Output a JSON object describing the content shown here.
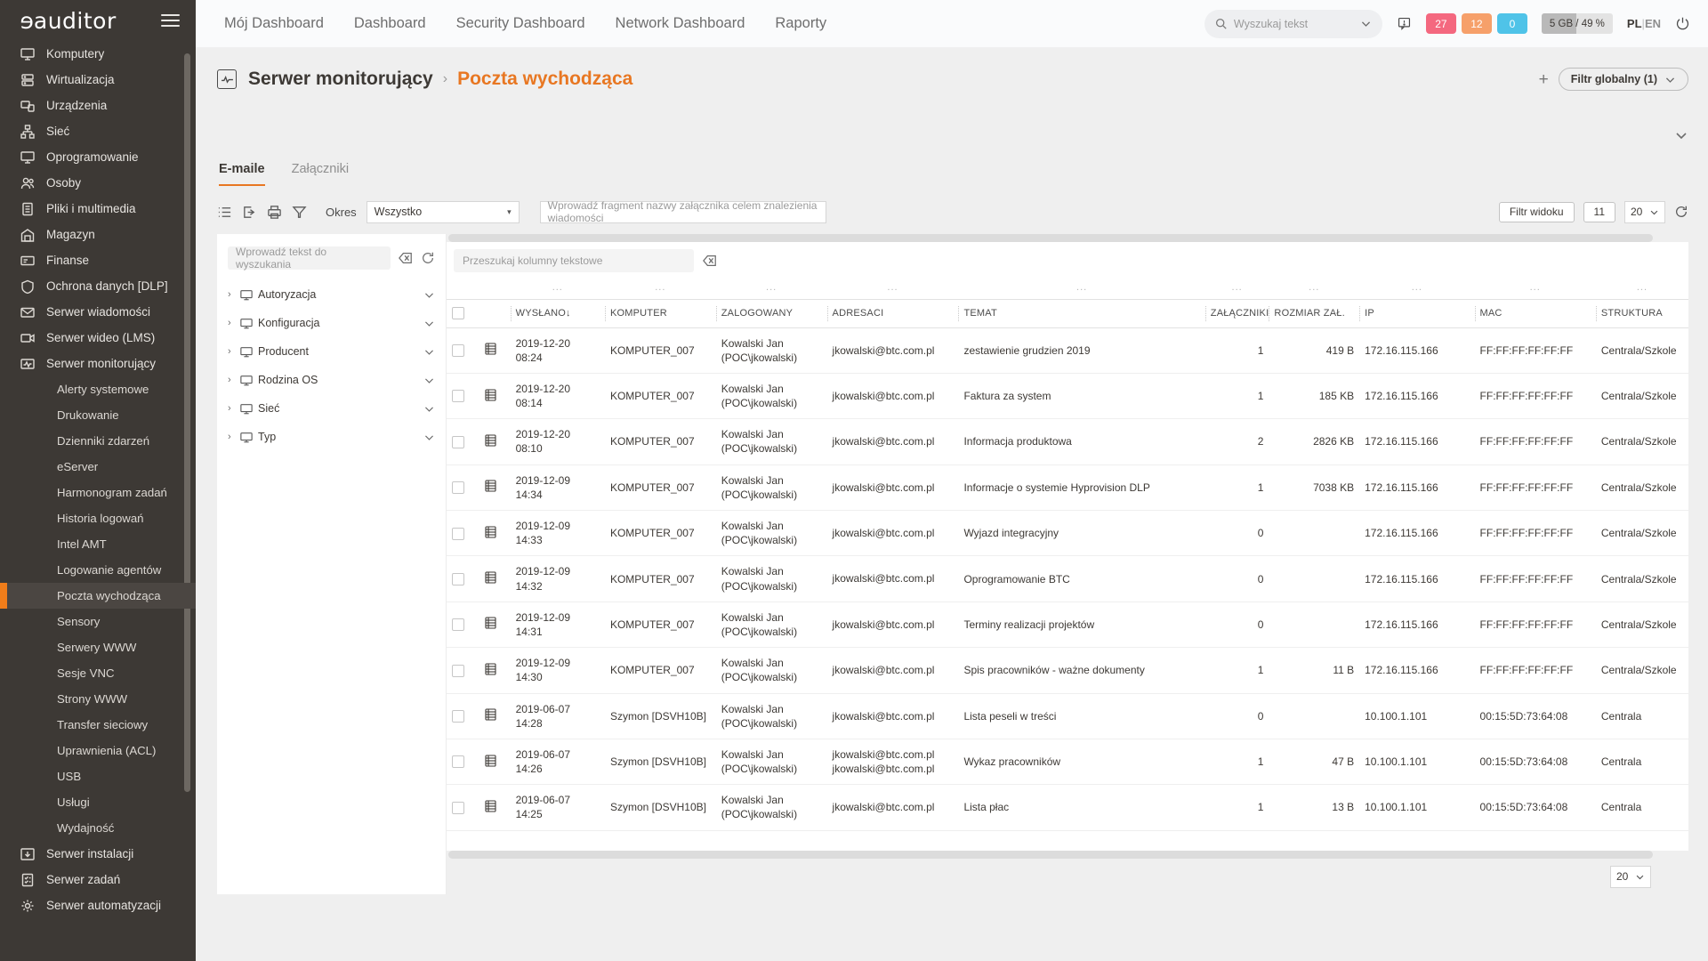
{
  "brand": {
    "name": "auditor",
    "logo_first": "e"
  },
  "sidebar": {
    "items": [
      {
        "label": "Komputery",
        "icon": "monitor-icon"
      },
      {
        "label": "Wirtualizacja",
        "icon": "servers-icon"
      },
      {
        "label": "Urządzenia",
        "icon": "devices-icon"
      },
      {
        "label": "Sieć",
        "icon": "network-icon"
      },
      {
        "label": "Oprogramowanie",
        "icon": "monitor-icon"
      },
      {
        "label": "Osoby",
        "icon": "people-icon"
      },
      {
        "label": "Pliki i multimedia",
        "icon": "file-icon"
      },
      {
        "label": "Magazyn",
        "icon": "warehouse-icon"
      },
      {
        "label": "Finanse",
        "icon": "card-icon"
      },
      {
        "label": "Ochrona danych [DLP]",
        "icon": "shield-icon"
      },
      {
        "label": "Serwer wiadomości",
        "icon": "envelope-icon"
      },
      {
        "label": "Serwer wideo (LMS)",
        "icon": "video-icon"
      },
      {
        "label": "Serwer monitorujący",
        "icon": "monitoring-icon"
      }
    ],
    "sub_items": [
      {
        "label": "Alerty systemowe",
        "active": false
      },
      {
        "label": "Drukowanie",
        "active": false
      },
      {
        "label": "Dzienniki zdarzeń",
        "active": false
      },
      {
        "label": "eServer",
        "active": false
      },
      {
        "label": "Harmonogram zadań",
        "active": false
      },
      {
        "label": "Historia logowań",
        "active": false
      },
      {
        "label": "Intel AMT",
        "active": false
      },
      {
        "label": "Logowanie agentów",
        "active": false
      },
      {
        "label": "Poczta wychodząca",
        "active": true
      },
      {
        "label": "Sensory",
        "active": false
      },
      {
        "label": "Serwery WWW",
        "active": false
      },
      {
        "label": "Sesje VNC",
        "active": false
      },
      {
        "label": "Strony WWW",
        "active": false
      },
      {
        "label": "Transfer sieciowy",
        "active": false
      },
      {
        "label": "Uprawnienia (ACL)",
        "active": false
      },
      {
        "label": "USB",
        "active": false
      },
      {
        "label": "Usługi",
        "active": false
      },
      {
        "label": "Wydajność",
        "active": false
      }
    ],
    "items_after": [
      {
        "label": "Serwer instalacji",
        "icon": "install-icon"
      },
      {
        "label": "Serwer zadań",
        "icon": "tasks-icon"
      },
      {
        "label": "Serwer automatyzacji",
        "icon": "automation-icon"
      }
    ]
  },
  "topnav": {
    "items": [
      {
        "label": "Mój Dashboard",
        "selected": false
      },
      {
        "label": "Dashboard",
        "selected": false
      },
      {
        "label": "Security Dashboard",
        "selected": false
      },
      {
        "label": "Network Dashboard",
        "selected": false
      },
      {
        "label": "Raporty",
        "selected": false
      }
    ],
    "search_placeholder": "Wyszukaj tekst",
    "badges": [
      {
        "value": "27",
        "color": "#f4687f"
      },
      {
        "value": "12",
        "color": "#f6a06a"
      },
      {
        "value": "0",
        "color": "#4fc3e8"
      }
    ],
    "storage": {
      "text": "5 GB / 49 %",
      "used_label": "5 GB",
      "percent_label": "49 %",
      "percent": 49
    },
    "lang": {
      "active": "PL",
      "separator": "|",
      "other": "EN"
    }
  },
  "page": {
    "breadcrumb_parent": "Serwer monitorujący",
    "breadcrumb_sep": "›",
    "breadcrumb_current": "Poczta wychodząca",
    "add_label": "+",
    "global_filter_label": "Filtr globalny (1)"
  },
  "tabs": [
    {
      "label": "E-maile",
      "active": true
    },
    {
      "label": "Załączniki",
      "active": false
    }
  ],
  "toolbar": {
    "period_label": "Okres",
    "period_value": "Wszystko",
    "attachment_placeholder": "Wprowadź fragment nazwy załącznika celem znalezienia wiadomości",
    "view_filter_label": "Filtr widoku",
    "count_label": "11",
    "page_size": "20",
    "icons": [
      "list-settings-icon",
      "export-icon",
      "print-icon",
      "filter-icon",
      "refresh-icon"
    ]
  },
  "filter_panel": {
    "search_placeholder": "Wprowadź tekst do wyszukania",
    "tree": [
      {
        "label": "Autoryzacja"
      },
      {
        "label": "Konfiguracja"
      },
      {
        "label": "Producent"
      },
      {
        "label": "Rodzina OS"
      },
      {
        "label": "Sieć"
      },
      {
        "label": "Typ"
      }
    ]
  },
  "table": {
    "column_search_placeholder": "Przeszukaj kolumny tekstowe",
    "dots": "...",
    "columns": [
      {
        "key": "sent",
        "label": "WYSŁANO",
        "sorted": true,
        "sort_dir": "↓"
      },
      {
        "key": "computer",
        "label": "KOMPUTER"
      },
      {
        "key": "logged",
        "label": "ZALOGOWANY"
      },
      {
        "key": "recipients",
        "label": "ADRESACI"
      },
      {
        "key": "subject",
        "label": "TEMAT"
      },
      {
        "key": "attachments",
        "label": "ZAŁĄCZNIKI"
      },
      {
        "key": "size",
        "label": "ROZMIAR ZAŁ."
      },
      {
        "key": "ip",
        "label": "IP"
      },
      {
        "key": "mac",
        "label": "MAC"
      },
      {
        "key": "structure",
        "label": "STRUKTURA"
      }
    ],
    "rows": [
      {
        "date": "2019-12-20",
        "time": "08:24",
        "computer": "KOMPUTER_007",
        "logged1": "Kowalski Jan",
        "logged2": "(POC\\jkowalski)",
        "recipients": [
          "jkowalski@btc.com.pl"
        ],
        "subject": "zestawienie grudzien 2019",
        "attachments": "1",
        "attachments_hl": true,
        "size": "419 B",
        "ip": "172.16.115.166",
        "mac": "FF:FF:FF:FF:FF:FF",
        "structure": "Centrala/Szkole"
      },
      {
        "date": "2019-12-20",
        "time": "08:14",
        "computer": "KOMPUTER_007",
        "logged1": "Kowalski Jan",
        "logged2": "(POC\\jkowalski)",
        "recipients": [
          "jkowalski@btc.com.pl"
        ],
        "subject": "Faktura za system",
        "attachments": "1",
        "attachments_hl": true,
        "size": "185 KB",
        "ip": "172.16.115.166",
        "mac": "FF:FF:FF:FF:FF:FF",
        "structure": "Centrala/Szkole"
      },
      {
        "date": "2019-12-20",
        "time": "08:10",
        "computer": "KOMPUTER_007",
        "logged1": "Kowalski Jan",
        "logged2": "(POC\\jkowalski)",
        "recipients": [
          "jkowalski@btc.com.pl"
        ],
        "subject": "Informacja produktowa",
        "attachments": "2",
        "attachments_hl": true,
        "size": "2826 KB",
        "ip": "172.16.115.166",
        "mac": "FF:FF:FF:FF:FF:FF",
        "structure": "Centrala/Szkole"
      },
      {
        "date": "2019-12-09",
        "time": "14:34",
        "computer": "KOMPUTER_007",
        "logged1": "Kowalski Jan",
        "logged2": "(POC\\jkowalski)",
        "recipients": [
          "jkowalski@btc.com.pl"
        ],
        "subject": "Informacje o systemie Hyprovision DLP",
        "attachments": "1",
        "attachments_hl": true,
        "size": "7038 KB",
        "ip": "172.16.115.166",
        "mac": "FF:FF:FF:FF:FF:FF",
        "structure": "Centrala/Szkole"
      },
      {
        "date": "2019-12-09",
        "time": "14:33",
        "computer": "KOMPUTER_007",
        "logged1": "Kowalski Jan",
        "logged2": "(POC\\jkowalski)",
        "recipients": [
          "jkowalski@btc.com.pl"
        ],
        "subject": "Wyjazd integracyjny",
        "attachments": "0",
        "attachments_hl": false,
        "size": "",
        "ip": "172.16.115.166",
        "mac": "FF:FF:FF:FF:FF:FF",
        "structure": "Centrala/Szkole"
      },
      {
        "date": "2019-12-09",
        "time": "14:32",
        "computer": "KOMPUTER_007",
        "logged1": "Kowalski Jan",
        "logged2": "(POC\\jkowalski)",
        "recipients": [
          "jkowalski@btc.com.pl"
        ],
        "subject": "Oprogramowanie BTC",
        "attachments": "0",
        "attachments_hl": false,
        "size": "",
        "ip": "172.16.115.166",
        "mac": "FF:FF:FF:FF:FF:FF",
        "structure": "Centrala/Szkole"
      },
      {
        "date": "2019-12-09",
        "time": "14:31",
        "computer": "KOMPUTER_007",
        "logged1": "Kowalski Jan",
        "logged2": "(POC\\jkowalski)",
        "recipients": [
          "jkowalski@btc.com.pl"
        ],
        "subject": "Terminy realizacji projektów",
        "attachments": "0",
        "attachments_hl": false,
        "size": "",
        "ip": "172.16.115.166",
        "mac": "FF:FF:FF:FF:FF:FF",
        "structure": "Centrala/Szkole"
      },
      {
        "date": "2019-12-09",
        "time": "14:30",
        "computer": "KOMPUTER_007",
        "logged1": "Kowalski Jan",
        "logged2": "(POC\\jkowalski)",
        "recipients": [
          "jkowalski@btc.com.pl"
        ],
        "subject": "Spis pracowników - ważne dokumenty",
        "attachments": "1",
        "attachments_hl": true,
        "size": "11 B",
        "ip": "172.16.115.166",
        "mac": "FF:FF:FF:FF:FF:FF",
        "structure": "Centrala/Szkole"
      },
      {
        "date": "2019-06-07",
        "time": "14:28",
        "computer": "Szymon [DSVH10B]",
        "logged1": "Kowalski Jan",
        "logged2": "(POC\\jkowalski)",
        "recipients": [
          "jkowalski@btc.com.pl"
        ],
        "subject": "Lista peseli w treści",
        "attachments": "0",
        "attachments_hl": false,
        "size": "",
        "ip": "10.100.1.101",
        "mac": "00:15:5D:73:64:08",
        "structure": "Centrala"
      },
      {
        "date": "2019-06-07",
        "time": "14:26",
        "computer": "Szymon [DSVH10B]",
        "logged1": "Kowalski Jan",
        "logged2": "(POC\\jkowalski)",
        "recipients": [
          "jkowalski@btc.com.pl",
          "jkowalski@btc.com.pl"
        ],
        "subject": "Wykaz pracowników",
        "attachments": "1",
        "attachments_hl": true,
        "size": "47 B",
        "ip": "10.100.1.101",
        "mac": "00:15:5D:73:64:08",
        "structure": "Centrala"
      },
      {
        "date": "2019-06-07",
        "time": "14:25",
        "computer": "Szymon [DSVH10B]",
        "logged1": "Kowalski Jan",
        "logged2": "(POC\\jkowalski)",
        "recipients": [
          "jkowalski@btc.com.pl"
        ],
        "subject": "Lista płac",
        "attachments": "1",
        "attachments_hl": true,
        "size": "13 B",
        "ip": "10.100.1.101",
        "mac": "00:15:5D:73:64:08",
        "structure": "Centrala"
      }
    ],
    "footer_page_size": "20"
  },
  "colors": {
    "accent": "#e87722",
    "sidebar_bg": "#3d3935",
    "page_bg": "#efefef"
  }
}
